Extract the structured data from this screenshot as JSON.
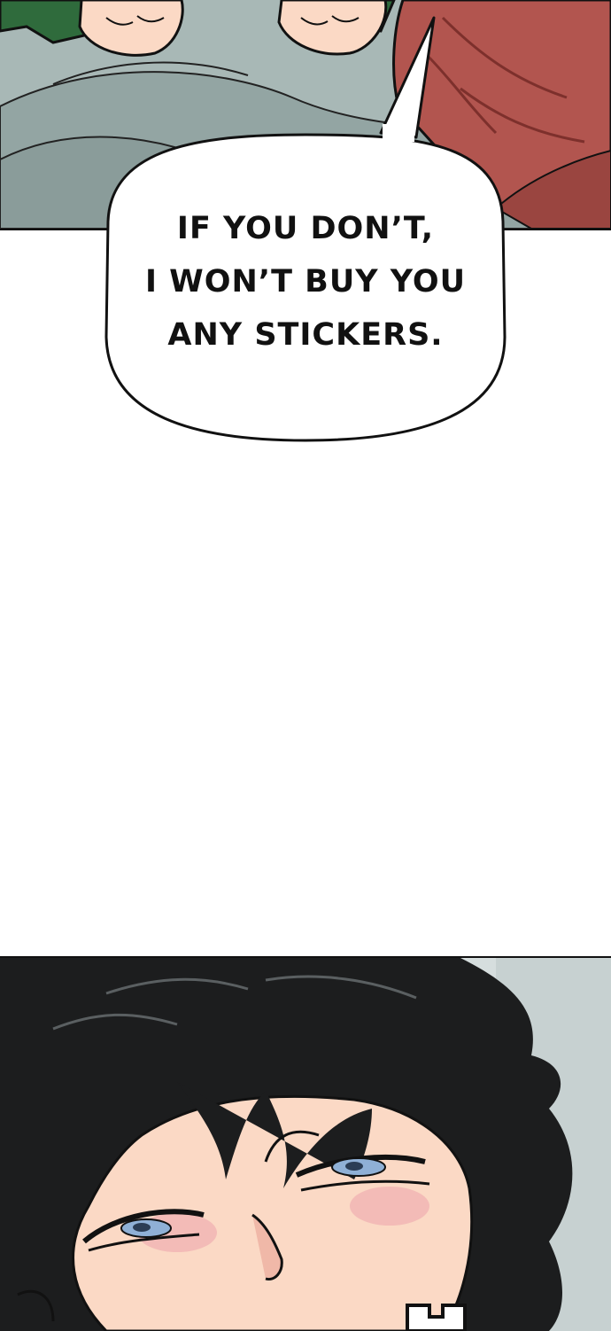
{
  "speech_bubble": {
    "lines": [
      "IF YOU DON’T,",
      "I WON’T BUY YOU",
      "ANY STICKERS."
    ]
  },
  "colors": {
    "blanket": "#9fb0ae",
    "sleeve_red": "#b2554f",
    "sleeve_green": "#2f6b3c",
    "skin": "#fbd9c5",
    "hair": "#1c1d1e",
    "eye_iris": "#8fb0d6",
    "blush": "#f1b3b3"
  }
}
